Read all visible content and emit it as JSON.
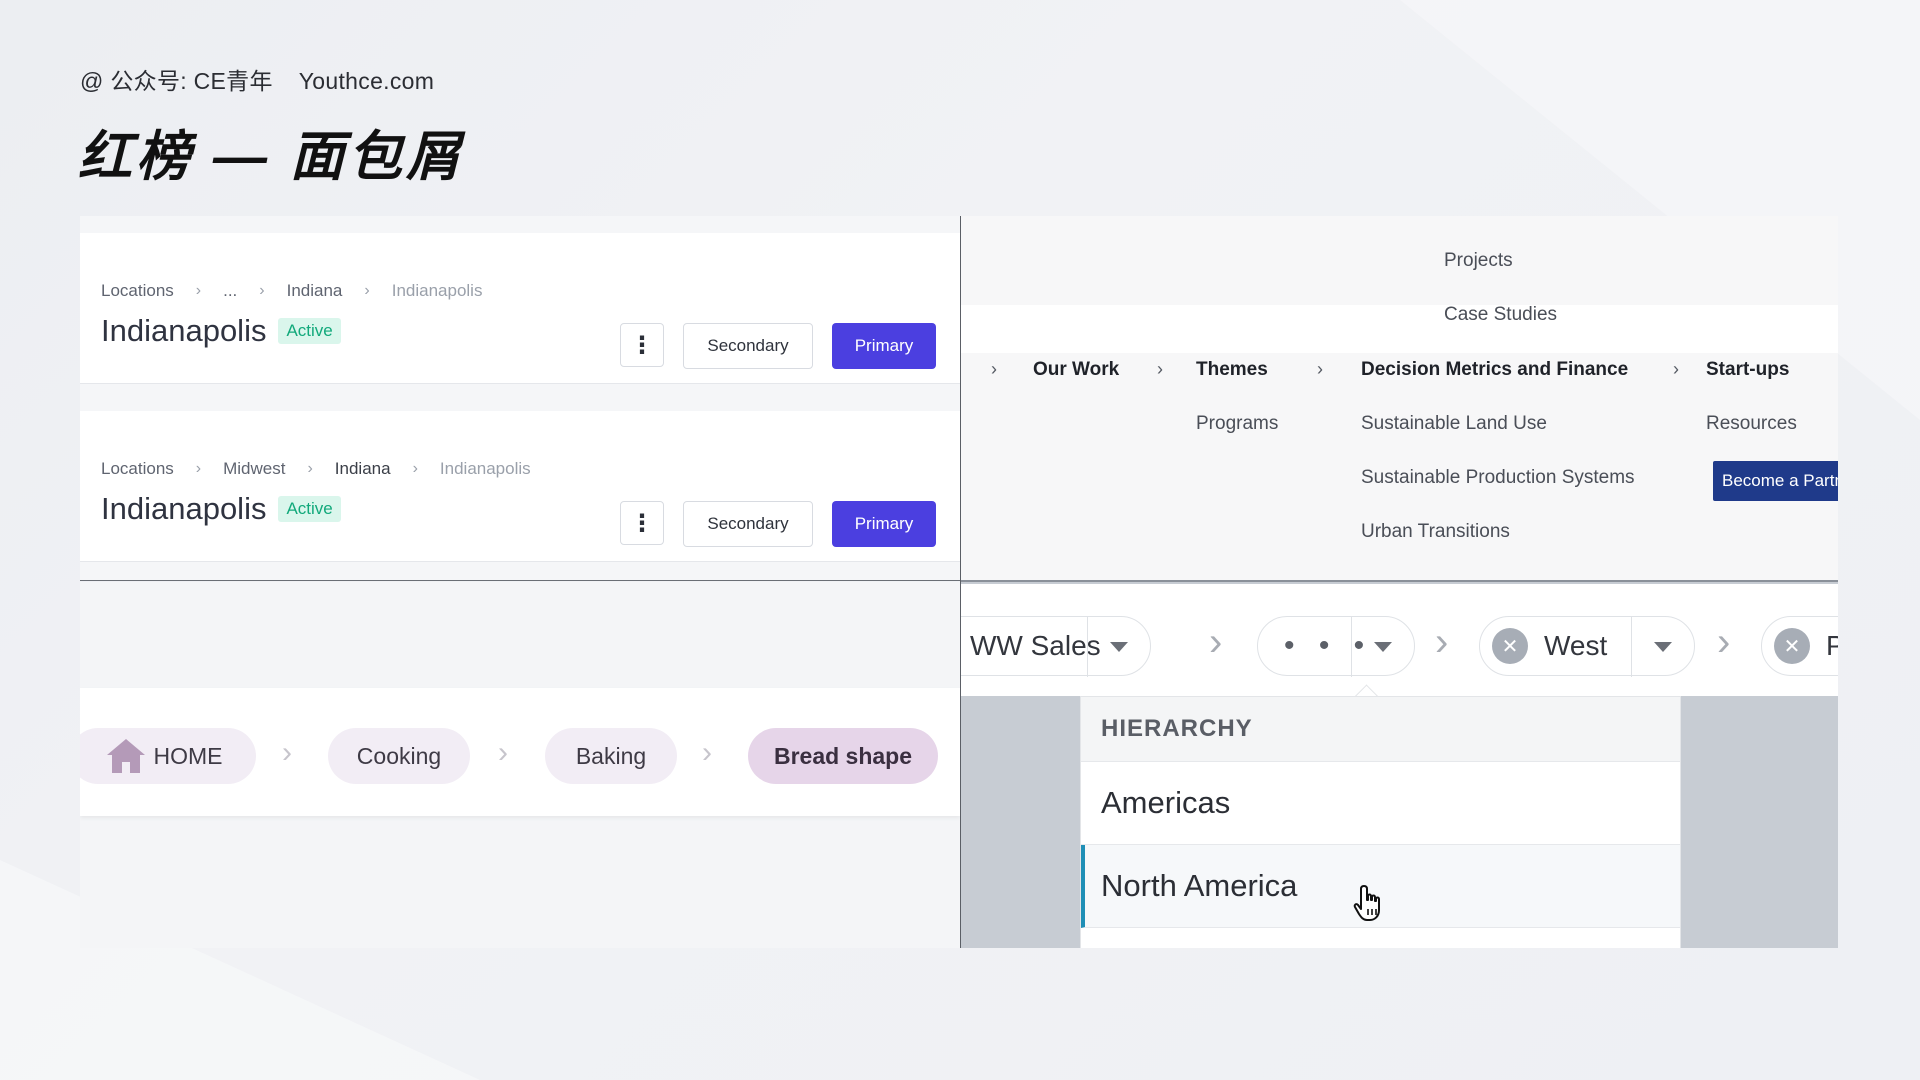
{
  "header": {
    "credit_prefix": "@ 公众号: CE青年",
    "credit_site": "Youthce.com",
    "title": "红榜 — 面包屑"
  },
  "cards": [
    {
      "crumbs": [
        "Locations",
        "...",
        "Indiana",
        "Indianapolis"
      ],
      "title": "Indianapolis",
      "badge": "Active",
      "secondary": "Secondary",
      "primary": "Primary"
    },
    {
      "crumbs": [
        "Locations",
        "Midwest",
        "Indiana",
        "Indianapolis"
      ],
      "title": "Indianapolis",
      "badge": "Active",
      "secondary": "Secondary",
      "primary": "Primary"
    }
  ],
  "mega_menu": {
    "path": [
      "Our Work",
      "Themes",
      "Decision Metrics and Finance",
      "Start-ups"
    ],
    "themes_children": [
      "Programs"
    ],
    "decision_children": [
      "Sustainable Land Use",
      "Sustainable Production Systems",
      "Urban Transitions"
    ],
    "startups_above": [
      "Projects",
      "Case Studies"
    ],
    "startups_below": [
      "Resources"
    ],
    "cta": "Become a Partner"
  },
  "pill_crumbs": {
    "items": [
      "HOME",
      "Cooking",
      "Baking",
      "Bread shape"
    ],
    "active_index": 3
  },
  "chip_crumbs": {
    "items": [
      "WW Sales",
      "• • •",
      "West",
      "P"
    ],
    "dropdown": {
      "header": "HIERARCHY",
      "options": [
        "Americas",
        "North America"
      ],
      "selected_index": 1
    }
  },
  "colors": {
    "primary_button": "#4b3fe0",
    "active_badge_text": "#12a97b",
    "active_badge_bg": "#daf6ec",
    "pill_active": "#e6d5e9",
    "cta_dark_blue": "#1f3a8a",
    "dropdown_selected_accent": "#1f8fb6"
  }
}
